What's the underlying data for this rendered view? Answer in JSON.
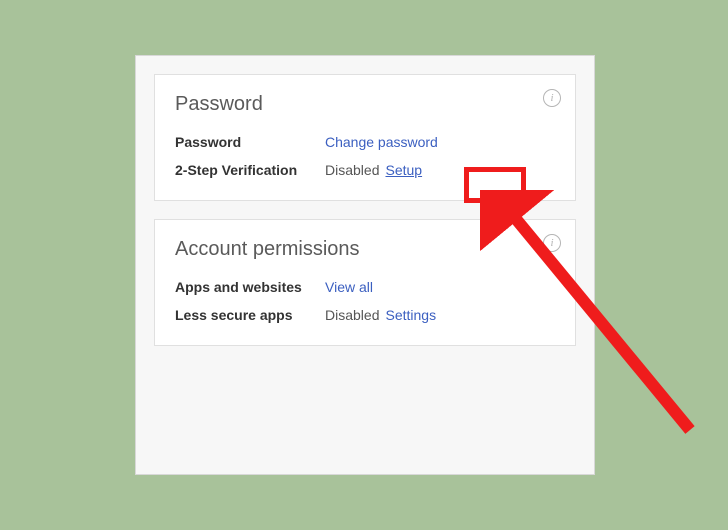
{
  "password_card": {
    "title": "Password",
    "password_label": "Password",
    "change_password_link": "Change password",
    "two_step_label": "2-Step Verification",
    "two_step_status": "Disabled",
    "setup_link": "Setup"
  },
  "permissions_card": {
    "title": "Account permissions",
    "apps_label": "Apps and websites",
    "view_all_link": "View all",
    "less_secure_label": "Less secure apps",
    "less_secure_status": "Disabled",
    "settings_link": "Settings"
  }
}
